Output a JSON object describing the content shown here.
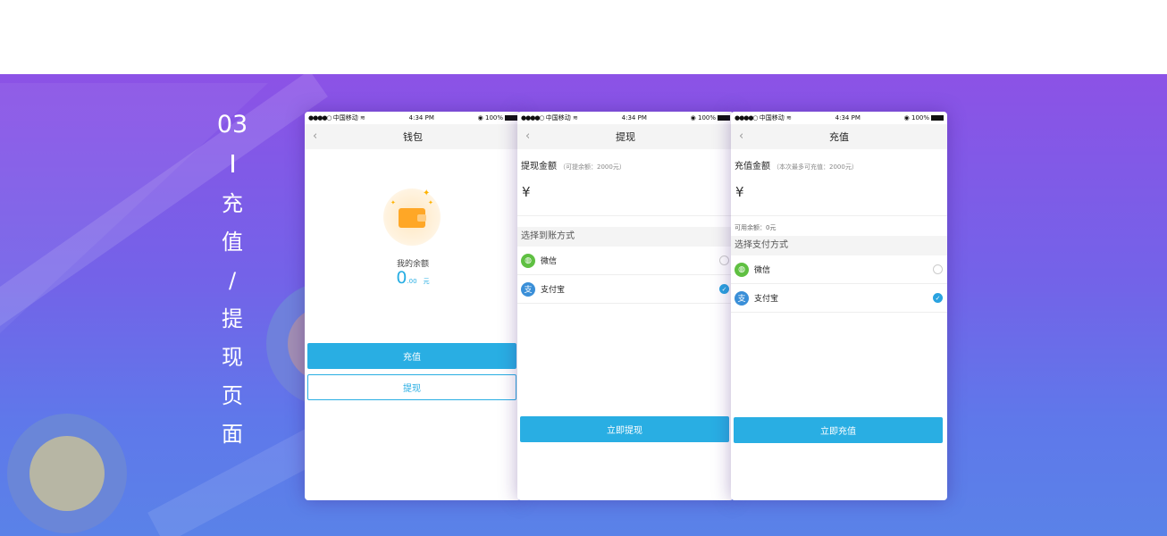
{
  "section": {
    "number": "03",
    "title_chars": [
      "充",
      "值",
      "/",
      "提",
      "现",
      "页",
      "面"
    ]
  },
  "status": {
    "carrier": "中国移动",
    "time": "4:34 PM",
    "battery": "100%"
  },
  "wallet_screen": {
    "nav_title": "钱包",
    "balance_label": "我的余额",
    "balance_int": "0",
    "balance_dec": ".00",
    "balance_unit": "元",
    "recharge_button": "充值",
    "withdraw_button": "提现"
  },
  "withdraw_screen": {
    "nav_title": "提现",
    "amount_label": "提现金额",
    "amount_hint": "（可提余额：2000元）",
    "currency": "¥",
    "method_header": "选择到账方式",
    "methods": [
      {
        "name": "微信",
        "icon": "wechat-icon",
        "selected": false
      },
      {
        "name": "支付宝",
        "icon": "alipay-icon",
        "selected": true
      }
    ],
    "submit_button": "立即提现"
  },
  "recharge_screen": {
    "nav_title": "充值",
    "amount_label": "充值金额",
    "amount_hint": "（本次最多可充值：2000元）",
    "currency": "¥",
    "available_balance": "可用余额：0元",
    "method_header": "选择支付方式",
    "methods": [
      {
        "name": "微信",
        "icon": "wechat-icon",
        "selected": false
      },
      {
        "name": "支付宝",
        "icon": "alipay-icon",
        "selected": true
      }
    ],
    "submit_button": "立即充值"
  },
  "colors": {
    "accent": "#29aee3",
    "wechat": "#5fc042",
    "alipay": "#3a8fd8",
    "wallet": "#ffa726"
  }
}
